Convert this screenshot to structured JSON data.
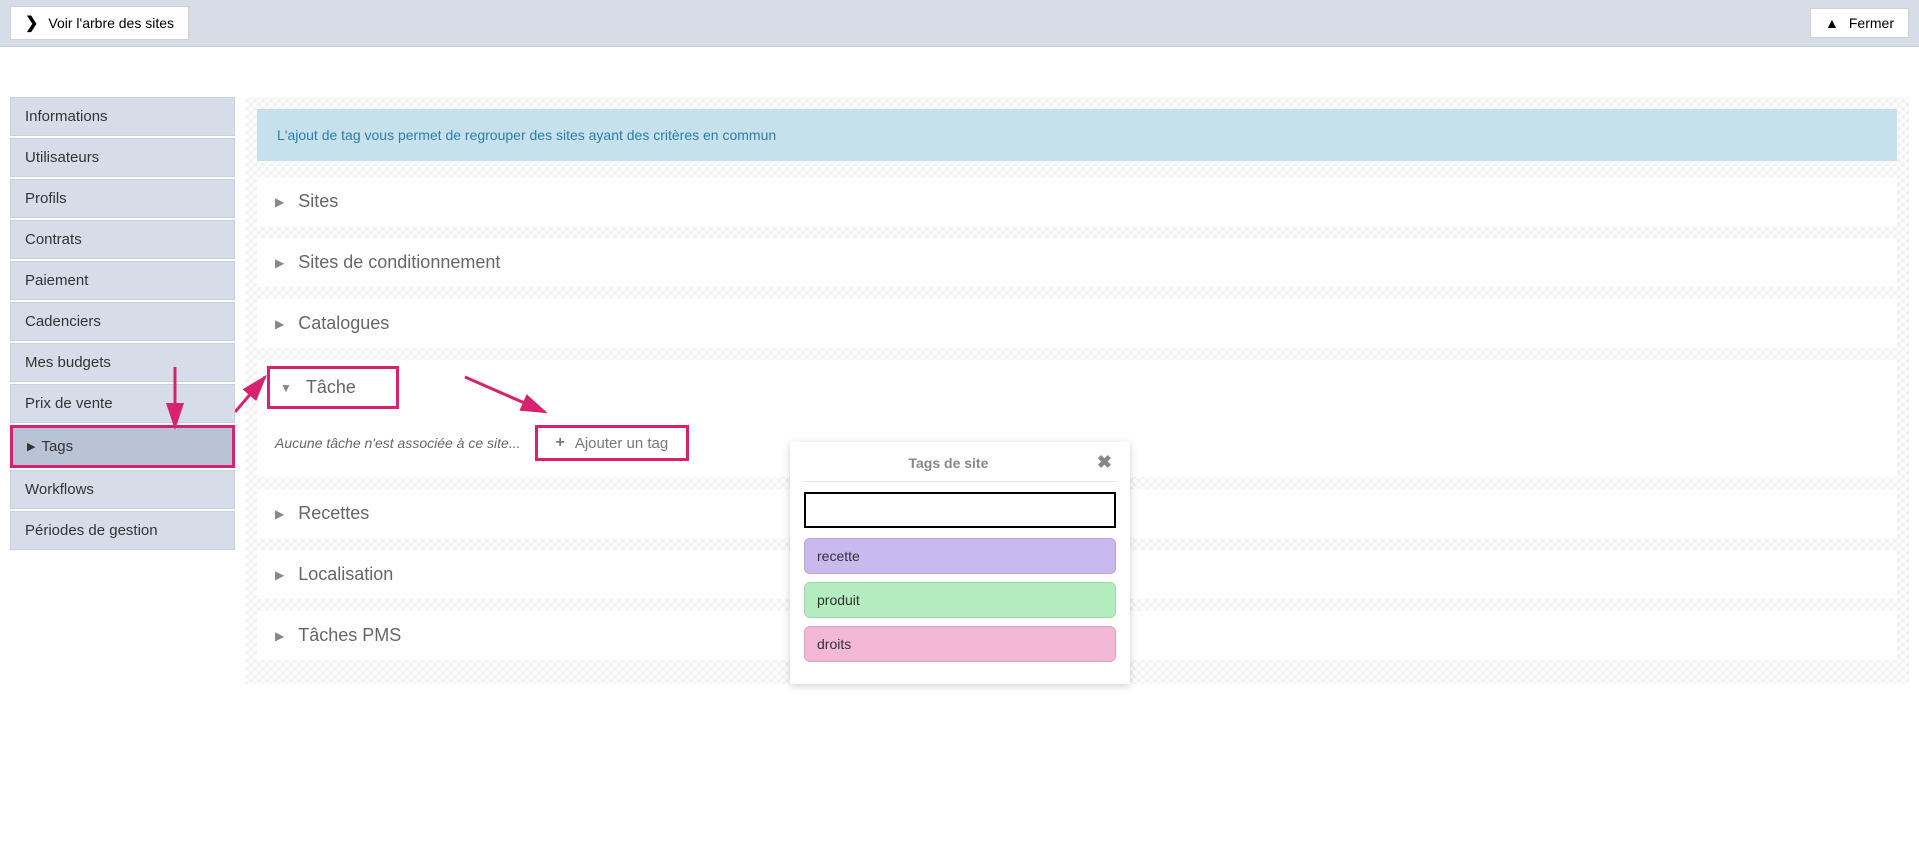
{
  "topbar": {
    "view_tree": "Voir l'arbre des sites",
    "close": "Fermer"
  },
  "sidebar": {
    "items": [
      {
        "label": "Informations"
      },
      {
        "label": "Utilisateurs"
      },
      {
        "label": "Profils"
      },
      {
        "label": "Contrats"
      },
      {
        "label": "Paiement"
      },
      {
        "label": "Cadenciers"
      },
      {
        "label": "Mes budgets"
      },
      {
        "label": "Prix de vente"
      },
      {
        "label": "Tags",
        "active": true
      },
      {
        "label": "Workflows"
      },
      {
        "label": "Périodes de gestion"
      }
    ]
  },
  "content": {
    "banner": "L'ajout de tag vous permet de regrouper des sites ayant des critères en commun",
    "sections": {
      "sites": "Sites",
      "sites_cond": "Sites de conditionnement",
      "catalogues": "Catalogues",
      "tache": "Tâche",
      "recettes": "Recettes",
      "localisation": "Localisation",
      "taches_pms": "Tâches PMS"
    },
    "tache_empty": "Aucune tâche n'est associée à ce site...",
    "add_tag": "Ajouter un tag"
  },
  "popup": {
    "title": "Tags de site",
    "input_value": "",
    "tags": [
      {
        "label": "recette",
        "color": "purple"
      },
      {
        "label": "produit",
        "color": "green"
      },
      {
        "label": "droits",
        "color": "pink"
      }
    ]
  }
}
